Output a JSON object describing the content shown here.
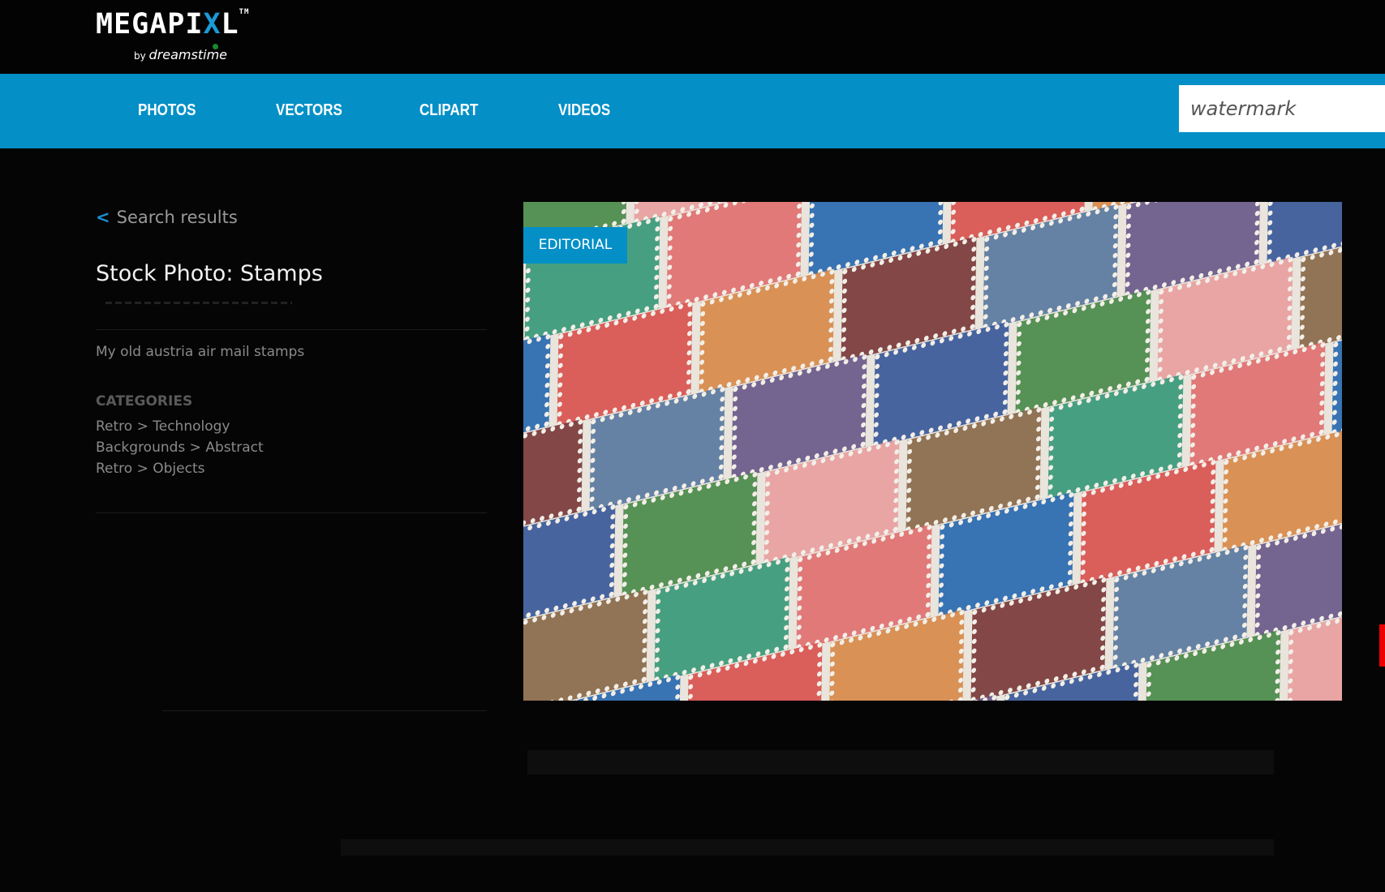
{
  "header": {
    "logo_text": "MEGAPIXL",
    "logo_sub": "by dreamstime"
  },
  "nav": {
    "items": [
      {
        "label": "PHOTOS"
      },
      {
        "label": "VECTORS"
      },
      {
        "label": "CLIPART"
      },
      {
        "label": "VIDEOS"
      }
    ],
    "search_value": "watermark"
  },
  "detail": {
    "back_label": "Search results",
    "title": "Stock Photo: Stamps",
    "description": "My old austria air mail stamps",
    "categories_heading": "CATEGORIES",
    "categories": [
      "Retro > Technology",
      "Backgrounds > Abstract",
      "Retro > Objects"
    ]
  },
  "photo": {
    "badge": "EDITORIAL"
  },
  "colors": {
    "nav": "#0490c7",
    "background": "#050505",
    "accent_red": "#e00000"
  }
}
